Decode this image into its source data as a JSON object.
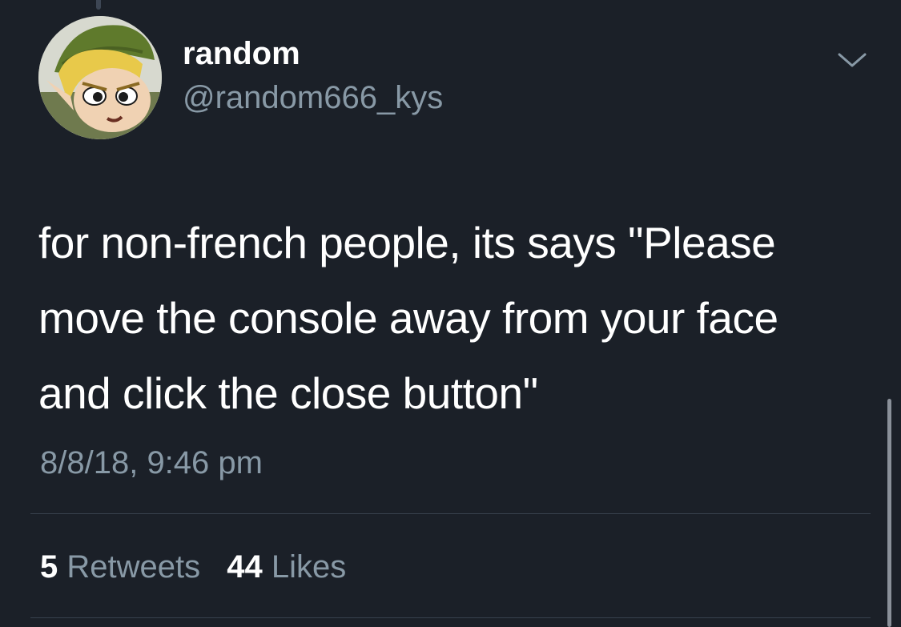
{
  "user": {
    "display_name": "random",
    "handle": "@random666_kys"
  },
  "tweet": {
    "text_lines": [
      "for non-french people, its says \"Please",
      "move the console away from your face",
      "and click the close button\""
    ],
    "timestamp": "8/8/18, 9:46 pm"
  },
  "stats": {
    "retweets_count": "5",
    "retweets_label": "Retweets",
    "likes_count": "44",
    "likes_label": "Likes"
  },
  "icons": {
    "menu": "chevron-down-icon"
  },
  "colors": {
    "background": "#1b2028",
    "primary_text": "#ffffff",
    "secondary_text": "#8899a6",
    "divider": "#38414d"
  }
}
